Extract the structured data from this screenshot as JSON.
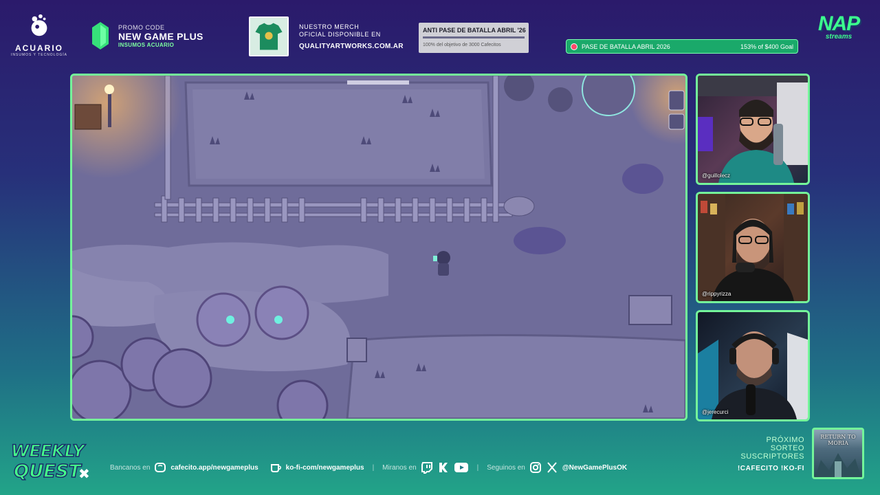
{
  "sponsor": {
    "name": "ACUARIO",
    "tagline": "INSUMOS Y TECNOLOGÍA"
  },
  "promo": {
    "label": "PROMO CODE",
    "code": "NEW GAME PLUS",
    "sub": "INSUMOS ACUARIO"
  },
  "merch": {
    "line1": "NUESTRO MERCH",
    "line2": "OFICIAL DISPONIBLE EN",
    "url": "QUALITYARTWORKS.COM.AR"
  },
  "anti_pase": {
    "title": "ANTI PASE DE BATALLA ABRIL '26",
    "detail": "100% del objetivo de 3000 Cafecitos",
    "progress": 1.0
  },
  "goal": {
    "title": "PASE DE BATALLA ABRIL 2026",
    "status": "153% of $400 Goal"
  },
  "brand": {
    "logo_text": "NAP",
    "logo_sub": "streams"
  },
  "cams": [
    {
      "handle": "@guillolecz"
    },
    {
      "handle": "@rippyrizza"
    },
    {
      "handle": "@jerecurci"
    }
  ],
  "show": {
    "logo_line1": "WEEKLY",
    "logo_line2": "QUEST"
  },
  "social": {
    "bancanos_label": "Bancanos en",
    "cafecito": "cafecito.app/newgameplus",
    "kofi": "ko-fi-com/newgameplus",
    "miranos_label": "Miranos en",
    "seguinos_label": "Seguinos en",
    "handle": "@NewGamePlusOK",
    "sep": "|"
  },
  "next_prize": {
    "line1": "PRÓXIMO",
    "line2": "SORTEO",
    "line3": "SUSCRIPTORES",
    "commands": "!CAFECITO  !KO-FI",
    "image_title": "RETURN TO MORIA"
  },
  "colors": {
    "accent": "#74f59a",
    "bg_top": "#2b1a6b",
    "bg_bottom": "#22a488",
    "game_ground": "#6f6c9a"
  }
}
